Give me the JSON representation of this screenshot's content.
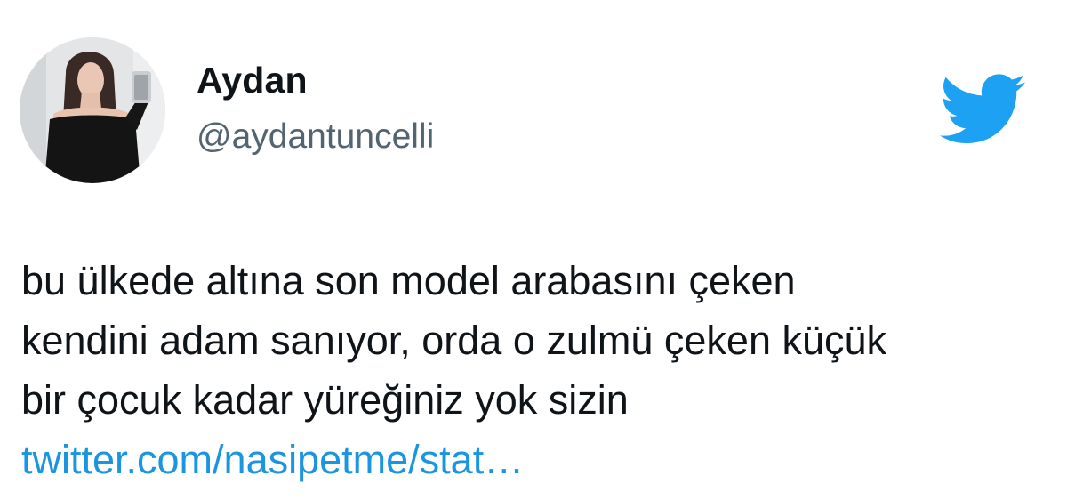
{
  "user": {
    "display_name": "Aydan",
    "handle": "@aydantuncelli"
  },
  "brand": {
    "icon": "twitter-bird-icon",
    "color": "#1da1f2"
  },
  "tweet": {
    "lines": [
      "bu ülkede altına son model arabasını çeken",
      "kendini adam sanıyor, orda o zulmü çeken küçük",
      "bir çocuk kadar yüreğiniz yok sizin"
    ],
    "link": "twitter.com/nasipetme/stat…",
    "link_color": "#1b95e0"
  }
}
